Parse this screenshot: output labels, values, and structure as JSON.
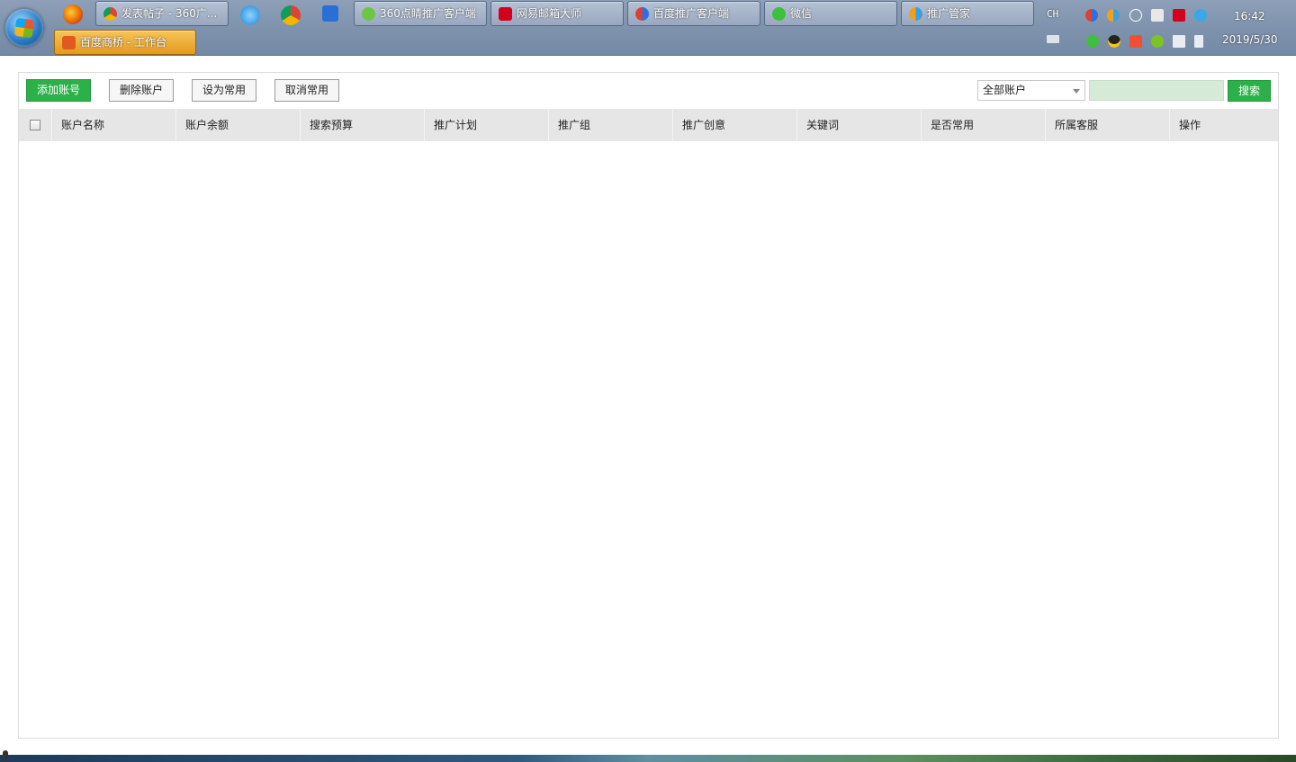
{
  "taskbar": {
    "windows": [
      {
        "label": "发表帖子 - 360广...",
        "icon": "chrome-icon",
        "color": "#4285f4"
      },
      {
        "label": "360点睛推广客户端",
        "icon": "360-dianjing-icon",
        "color": "#6cc644"
      },
      {
        "label": "网易邮箱大师",
        "icon": "netease-mail-icon",
        "color": "#d4001b"
      },
      {
        "label": "百度推广客户端",
        "icon": "baidu-promo-icon",
        "color": "#2f6fe0"
      },
      {
        "label": "微信",
        "icon": "wechat-icon",
        "color": "#3fbf3f"
      },
      {
        "label": "推广管家",
        "icon": "promo-manager-icon",
        "color": "#f0a020"
      },
      {
        "label": "百度商桥 - 工作台",
        "icon": "baidu-shangqiao-icon",
        "color": "#e05a20"
      }
    ],
    "pinned": [
      {
        "icon": "firefox-icon",
        "color": "#e66000"
      },
      {
        "icon": "ie-icon",
        "color": "#1c87d8"
      },
      {
        "icon": "chrome-pinned-icon",
        "color": "#db4437"
      },
      {
        "icon": "maxthon-icon",
        "color": "#2a6fd6"
      }
    ],
    "tray": {
      "lang": "CH",
      "time": "16:42",
      "date": "2019/5/30"
    }
  },
  "toolbar": {
    "add_label": "添加账号",
    "delete_label": "删除账户",
    "set_common_label": "设为常用",
    "cancel_common_label": "取消常用",
    "account_filter": "全部账户",
    "search_placeholder": "",
    "search_label": "搜索"
  },
  "table": {
    "columns": [
      "账户名称",
      "账户余额",
      "搜索预算",
      "推广计划",
      "推广组",
      "推广创意",
      "关键词",
      "是否常用",
      "所属客服",
      "操作"
    ],
    "rows": []
  },
  "colors": {
    "accent": "#2cb14a",
    "header_bg": "#e6e6e6",
    "search_input_bg": "#d5ead7"
  }
}
